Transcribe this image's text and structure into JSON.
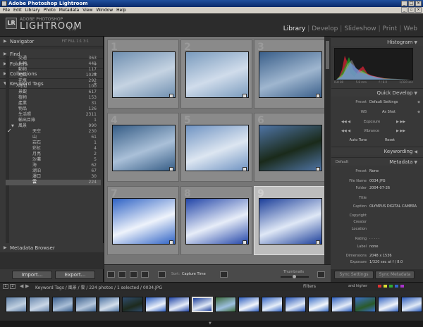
{
  "titlebar": {
    "title": "Adobe Photoshop Lightroom"
  },
  "menu": [
    "File",
    "Edit",
    "Library",
    "Photo",
    "Metadata",
    "View",
    "Window",
    "Help"
  ],
  "branding": {
    "company": "ADOBE PHOTOSHOP",
    "product": "LIGHTROOM",
    "version": "1.0",
    "badge": "LR"
  },
  "modules": [
    {
      "label": "Library",
      "active": true
    },
    {
      "label": "Develop",
      "active": false
    },
    {
      "label": "Slideshow",
      "active": false
    },
    {
      "label": "Print",
      "active": false
    },
    {
      "label": "Web",
      "active": false
    }
  ],
  "left_panels": {
    "navigator": "Navigator",
    "navigator_zoom": "FIT  FILL  1:1  3:1",
    "find": "Find",
    "folders": "Folders",
    "collections": "Collections",
    "keyword_tags": "Keyword Tags",
    "metadata_browser": "Metadata Browser"
  },
  "keywords": [
    {
      "label": "交通",
      "count": "363"
    },
    {
      "label": "人物",
      "count": "441"
    },
    {
      "label": "動物",
      "count": "117"
    },
    {
      "label": "地點",
      "count": "1028"
    },
    {
      "label": "花瓶",
      "count": "292"
    },
    {
      "label": "時間",
      "count": "100"
    },
    {
      "label": "景觀",
      "count": "617"
    },
    {
      "label": "植物",
      "count": "153"
    },
    {
      "label": "產業",
      "count": "31"
    },
    {
      "label": "物品",
      "count": "126"
    },
    {
      "label": "生活照",
      "count": "2311"
    },
    {
      "label": "輸出目錄",
      "count": "1"
    },
    {
      "label": "風景",
      "count": "990",
      "expanded": true
    },
    {
      "label": "天空",
      "count": "230",
      "indent": true,
      "checked": true
    },
    {
      "label": "山",
      "count": "61",
      "indent": true
    },
    {
      "label": "岩石",
      "count": "1",
      "indent": true
    },
    {
      "label": "彩虹",
      "count": "4",
      "indent": true
    },
    {
      "label": "月亮",
      "count": "2",
      "indent": true
    },
    {
      "label": "沙灘",
      "count": "5",
      "indent": true
    },
    {
      "label": "海",
      "count": "62",
      "indent": true
    },
    {
      "label": "湖泊",
      "count": "67",
      "indent": true
    },
    {
      "label": "瀑口",
      "count": "30",
      "indent": true
    },
    {
      "label": "雲",
      "count": "224",
      "indent": true,
      "selected": true
    }
  ],
  "buttons": {
    "import": "Import...",
    "export": "Export...",
    "sync_settings": "Sync Settings",
    "sync_metadata": "Sync Metadata"
  },
  "grid_cells": [
    {
      "num": "1",
      "colors": [
        "#6f8fb0",
        "#c5d3e2"
      ]
    },
    {
      "num": "2",
      "colors": [
        "#7a9bbd",
        "#d0dceb"
      ]
    },
    {
      "num": "3",
      "colors": [
        "#3a5f8a",
        "#9fb6cf"
      ]
    },
    {
      "num": "4",
      "colors": [
        "#365d86",
        "#aac0d8"
      ]
    },
    {
      "num": "5",
      "colors": [
        "#6f93c2",
        "#dde6f1"
      ]
    },
    {
      "num": "6",
      "colors": [
        "#4f74a5",
        "#1a2a1a"
      ]
    },
    {
      "num": "7",
      "colors": [
        "#2f63c5",
        "#eef3fb"
      ]
    },
    {
      "num": "8",
      "colors": [
        "#2245a8",
        "#e7edf8"
      ]
    },
    {
      "num": "9",
      "colors": [
        "#1c3f9a",
        "#dfe8f6"
      ],
      "selected": true
    }
  ],
  "histogram": {
    "title": "Histogram",
    "iso": "ISO 80",
    "focal": "5.8 mm",
    "fstop": "f / 8.0",
    "shutter": "1/320 sec"
  },
  "quick_develop": {
    "title": "Quick Develop",
    "preset_label": "Preset",
    "preset_value": "Default Settings",
    "wb_label": "WB",
    "wb_value": "As Shot",
    "exposure": "Exposure",
    "vibrance": "Vibrance",
    "auto_tone": "Auto Tone",
    "reset": "Reset"
  },
  "keywording": {
    "title": "Keywording"
  },
  "metadata": {
    "title": "Metadata",
    "default": "Default",
    "preset_label": "Preset",
    "preset_value": "None",
    "fields": [
      {
        "k": "File Name",
        "v": "0034.JPG"
      },
      {
        "k": "Folder",
        "v": "2004-07-26"
      },
      {
        "k": "Title",
        "v": ""
      },
      {
        "k": "Caption",
        "v": "OLYMPUS DIGITAL CAMERA"
      },
      {
        "k": "Copyright",
        "v": ""
      },
      {
        "k": "Creator",
        "v": ""
      },
      {
        "k": "Location",
        "v": ""
      },
      {
        "k": "Rating",
        "v": "· · · · ·"
      },
      {
        "k": "Label",
        "v": "none"
      },
      {
        "k": "Dimensions",
        "v": "2048 x 1536"
      },
      {
        "k": "Exposure",
        "v": "1/320 sec at f / 8.0"
      }
    ]
  },
  "toolbar": {
    "sort_label": "Sort:",
    "sort_value": "Capture Time",
    "thumbnails_label": "Thumbnails"
  },
  "filmstrip": {
    "page_labels": [
      "1",
      "2"
    ],
    "breadcrumb": "Keyword Tags / 風景 / 雲 / 224 photos / 1 selected / 0034.JPG",
    "filters": "Filters",
    "and_higher": "and higher",
    "flag_colors": [
      "#d33",
      "#dd3",
      "#3a3",
      "#36c",
      "#a3c"
    ]
  },
  "filmstrip_thumbs": [
    {
      "c1": "#5f7fa6",
      "c2": "#bfcfe0"
    },
    {
      "c1": "#6987ad",
      "c2": "#c9d6e6"
    },
    {
      "c1": "#3b5f8d",
      "c2": "#a9bed6"
    },
    {
      "c1": "#41648f",
      "c2": "#b4c6db"
    },
    {
      "c1": "#4e74a2",
      "c2": "#d2ddea"
    },
    {
      "c1": "#304d6e",
      "c2": "#1d2a1d"
    },
    {
      "c1": "#2e5fc0",
      "c2": "#eaf0fa"
    },
    {
      "c1": "#2145a6",
      "c2": "#e4ebf7"
    },
    {
      "c1": "#1c3f9a",
      "c2": "#dfe8f6",
      "cur": true
    },
    {
      "c1": "#3d6b3d",
      "c2": "#9ec0e0"
    },
    {
      "c1": "#2f5fbf",
      "c2": "#f0f4fa"
    },
    {
      "c1": "#3666c4",
      "c2": "#e5edf8"
    },
    {
      "c1": "#2a58b8",
      "c2": "#dce6f5"
    },
    {
      "c1": "#3a6ec6",
      "c2": "#f1f5fb"
    },
    {
      "c1": "#2d5fbd",
      "c2": "#e2eaf7"
    },
    {
      "c1": "#3b6fc9",
      "c2": "#2a5a2a"
    },
    {
      "c1": "#3565c2",
      "c2": "#eef2f9"
    },
    {
      "c1": "#2b5bba",
      "c2": "#e0e9f6"
    }
  ]
}
